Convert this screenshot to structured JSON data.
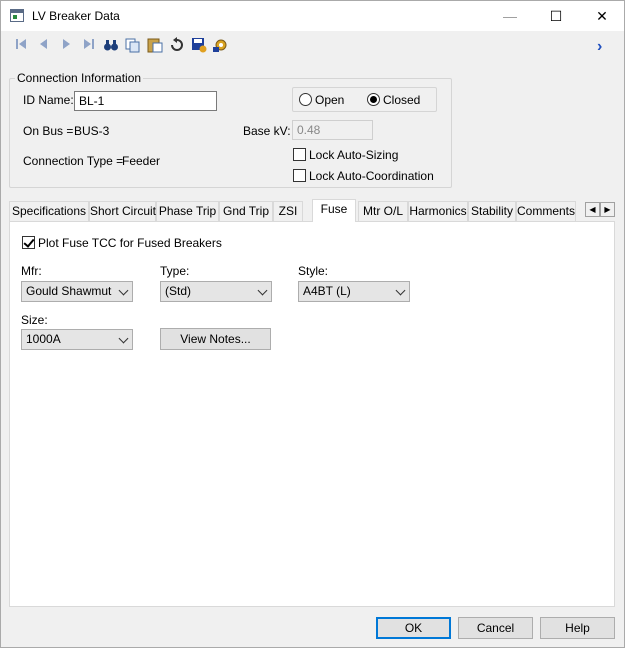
{
  "window": {
    "title": "LV Breaker Data",
    "minimize": "—",
    "maximize": "☐",
    "close": "✕"
  },
  "toolbar": {
    "icons": [
      "first-record-icon",
      "previous-record-icon",
      "next-record-icon",
      "last-record-icon",
      "find-icon",
      "copy-icon",
      "paste-icon",
      "undo-icon",
      "save-icon",
      "settings-icon"
    ],
    "more": "›"
  },
  "connection": {
    "group_title": "Connection Information",
    "id_label": "ID Name:",
    "id_value": "BL-1",
    "on_bus_label": "On Bus =",
    "on_bus_value": "BUS-3",
    "connection_type_label": "Connection Type =",
    "connection_type_value": "Feeder",
    "open_label": "Open",
    "closed_label": "Closed",
    "base_kv_label": "Base kV:",
    "base_kv_value": "0.48",
    "lock_sizing_label": "Lock Auto-Sizing",
    "lock_coord_label": "Lock Auto-Coordination"
  },
  "tabs": [
    {
      "label": "Specifications"
    },
    {
      "label": "Short Circuit"
    },
    {
      "label": "Phase Trip"
    },
    {
      "label": "Gnd Trip"
    },
    {
      "label": "ZSI"
    },
    {
      "label": "Fuse"
    },
    {
      "label": "Mtr O/L"
    },
    {
      "label": "Harmonics"
    },
    {
      "label": "Stability"
    },
    {
      "label": "Comments"
    }
  ],
  "fuse": {
    "plot_label": "Plot Fuse TCC for Fused Breakers",
    "mfr_label": "Mfr:",
    "mfr_value": "Gould Shawmut",
    "type_label": "Type:",
    "type_value": "(Std)",
    "style_label": "Style:",
    "style_value": "A4BT (L)",
    "size_label": "Size:",
    "size_value": "1000A",
    "view_notes": "View Notes..."
  },
  "buttons": {
    "ok": "OK",
    "cancel": "Cancel",
    "help": "Help"
  },
  "tab_scroll": {
    "left": "◀",
    "right": "▶"
  }
}
